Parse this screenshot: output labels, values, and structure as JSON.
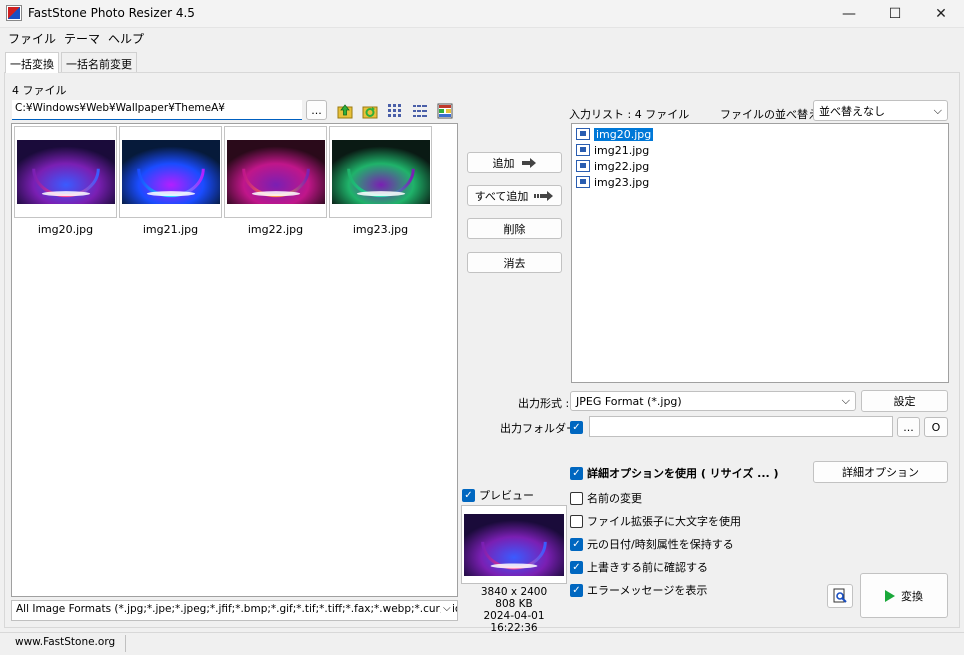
{
  "window": {
    "title": "FastStone Photo Resizer 4.5",
    "minimize_glyph": "—",
    "maximize_glyph": "☐",
    "close_glyph": "✕"
  },
  "menu": [
    "ファイル",
    "テーマ",
    "ヘルプ"
  ],
  "tabs": [
    "一括変換",
    "一括名前変更"
  ],
  "browser": {
    "file_count": "4 ファイル",
    "path": "C:¥Windows¥Web¥Wallpaper¥ThemeA¥",
    "browse_label": "...",
    "toolbar_icons": [
      "folder-up-icon",
      "refresh-icon",
      "thumbnail-view-icon",
      "list-view-icon",
      "detail-view-icon"
    ],
    "thumbnails": [
      {
        "name": "img20.jpg",
        "palette": [
          "#1a0b3a",
          "#7a1fb3",
          "#ff3d8a",
          "#3a5bff"
        ]
      },
      {
        "name": "img21.jpg",
        "palette": [
          "#061a3a",
          "#1a4cff",
          "#19d6ff",
          "#b31fff"
        ]
      },
      {
        "name": "img22.jpg",
        "palette": [
          "#2a0a1a",
          "#c0168a",
          "#ff8a3d",
          "#7a1fb3"
        ]
      },
      {
        "name": "img23.jpg",
        "palette": [
          "#0a1a14",
          "#1fb36a",
          "#19d6a8",
          "#7a1fb3"
        ]
      }
    ],
    "filter": "All Image Formats (*.jpg;*.jpe;*.jpeg;*.jfif;*.bmp;*.gif;*.tif;*.tiff;*.fax;*.webp;*.cur;*.ico;*.png;*"
  },
  "actions": {
    "add": "追加",
    "add_all": "すべて追加",
    "remove": "削除",
    "clear": "消去"
  },
  "input_list": {
    "header": "入力リスト : 4 ファイル",
    "sort_label": "ファイルの並べ替え :",
    "sort_value": "並べ替えなし",
    "files": [
      "img20.jpg",
      "img21.jpg",
      "img22.jpg",
      "img23.jpg"
    ],
    "selected_index": 0
  },
  "output": {
    "format_label": "出力形式 :",
    "format_value": "JPEG Format (*.jpg)",
    "settings_button": "設定",
    "folder_label": "出力フォルダー :",
    "folder_value": "",
    "browse_label": "...",
    "open_label": "O",
    "folder_checked": true
  },
  "preview": {
    "label": "プレビュー",
    "checked": true,
    "dimensions": "3840 x 2400",
    "size": "808 KB",
    "date": "2024-04-01 16:22:36"
  },
  "options": {
    "advanced_button": "詳細オプション",
    "items": [
      {
        "label": "詳細オプションを使用 ( リサイズ ... )",
        "checked": true,
        "bold": true
      },
      {
        "label": "名前の変更",
        "checked": false
      },
      {
        "label": "ファイル拡張子に大文字を使用",
        "checked": false
      },
      {
        "label": "元の日付/時刻属性を保持する",
        "checked": true
      },
      {
        "label": "上書きする前に確認する",
        "checked": true
      },
      {
        "label": "エラーメッセージを表示",
        "checked": true
      }
    ]
  },
  "convert_button": "変換",
  "status": {
    "website": "www.FastStone.org"
  },
  "colors": {
    "accent": "#0067c0",
    "selection": "#0078d7",
    "convert_icon": "#1aa83a"
  }
}
